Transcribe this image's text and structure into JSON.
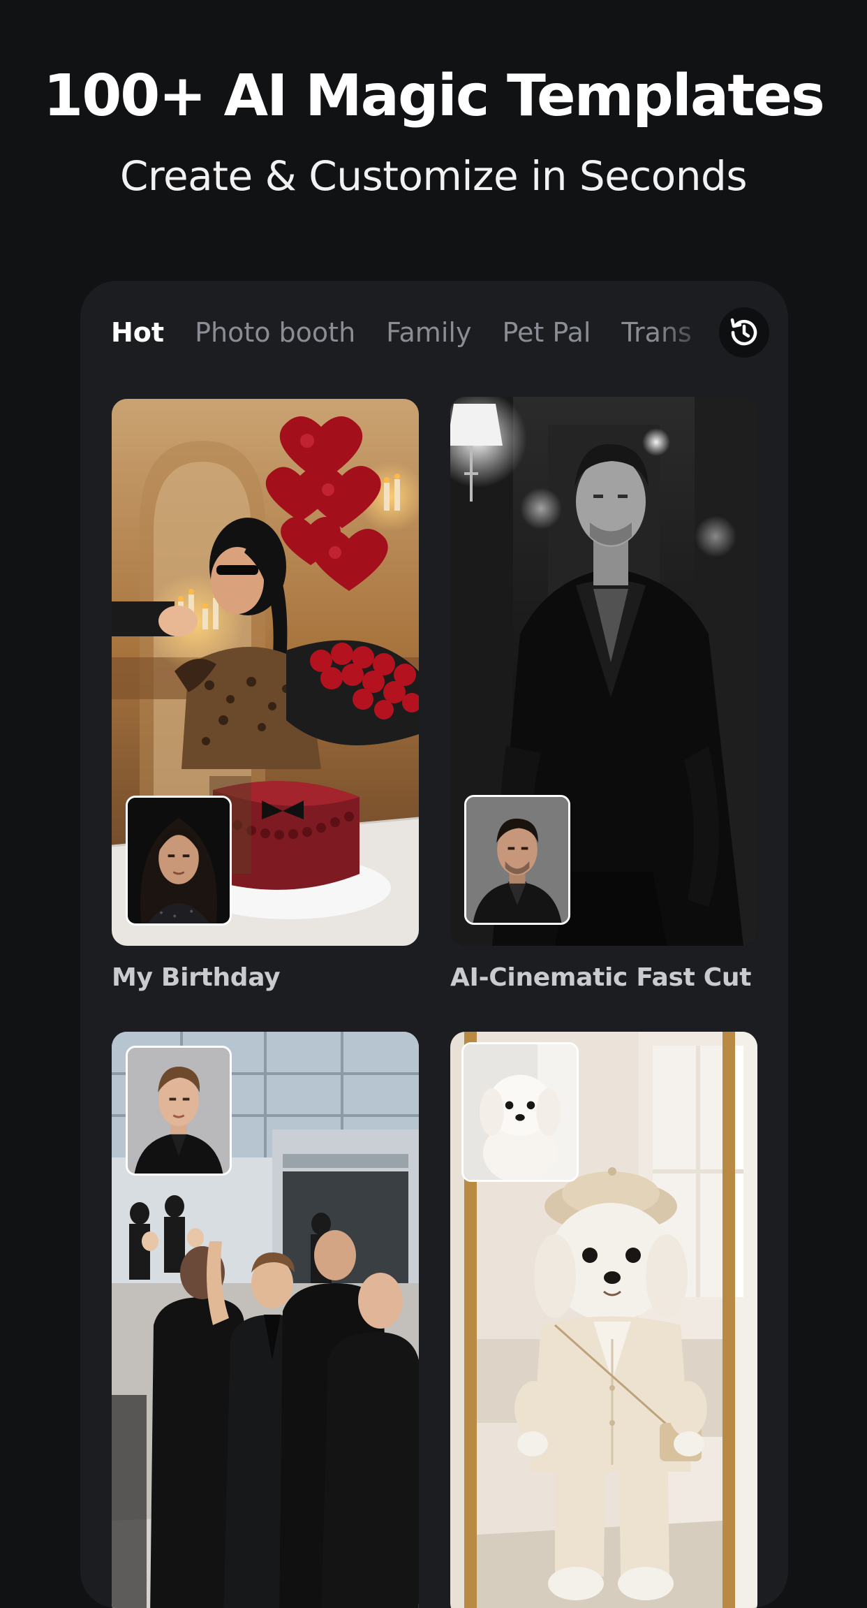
{
  "header": {
    "title": "100+ AI Magic Templates",
    "subtitle": "Create & Customize in Seconds"
  },
  "tabs": [
    {
      "label": "Hot",
      "active": true
    },
    {
      "label": "Photo booth",
      "active": false
    },
    {
      "label": "Family",
      "active": false
    },
    {
      "label": "Pet Pal",
      "active": false
    },
    {
      "label": "Trans",
      "active": false
    }
  ],
  "history_icon": "history-clock-icon",
  "templates": [
    {
      "title": "My Birthday",
      "image": "woman-with-birthday-cake-and-heart-balloons",
      "thumb": "woman-portrait"
    },
    {
      "title": "AI-Cinematic Fast Cut",
      "image": "man-in-black-suit-hallway",
      "thumb": "man-portrait"
    },
    {
      "title": "",
      "image": "celebrity-with-bodyguards-airport",
      "thumb": "man-in-suit-portrait"
    },
    {
      "title": "",
      "image": "dog-in-beige-suit-mirror",
      "thumb": "white-puppy-portrait"
    }
  ],
  "colors": {
    "background": "#111214",
    "panel": "#1b1d21",
    "active_tab": "#ffffff",
    "inactive_tab": "#8a8d93",
    "card_title": "#c9cbcf"
  }
}
